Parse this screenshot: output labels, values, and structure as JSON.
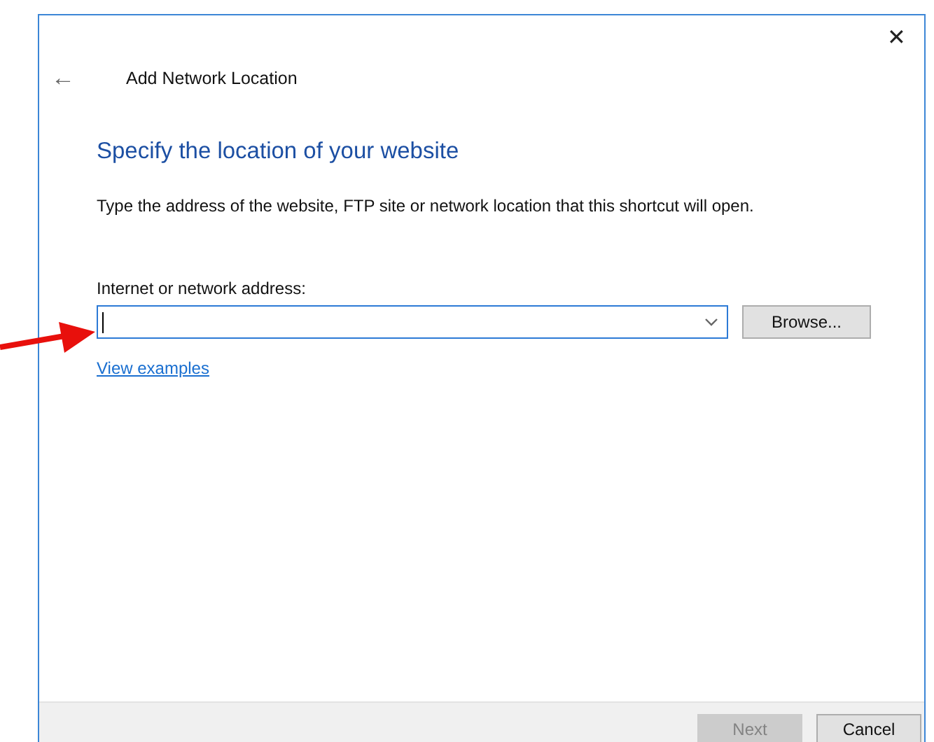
{
  "window": {
    "title": "Add Network Location",
    "close": "✕",
    "back": "←"
  },
  "heading": "Specify the location of your website",
  "description": "Type the address of the website, FTP site or network location that this shortcut will open.",
  "address_field": {
    "label": "Internet or network address:",
    "focused": true
  },
  "browse_button": "Browse...",
  "link": "View examples",
  "buttons": [
    {
      "label": "Next",
      "disabled": true
    },
    {
      "label": "Cancel",
      "disabled": false
    }
  ]
}
